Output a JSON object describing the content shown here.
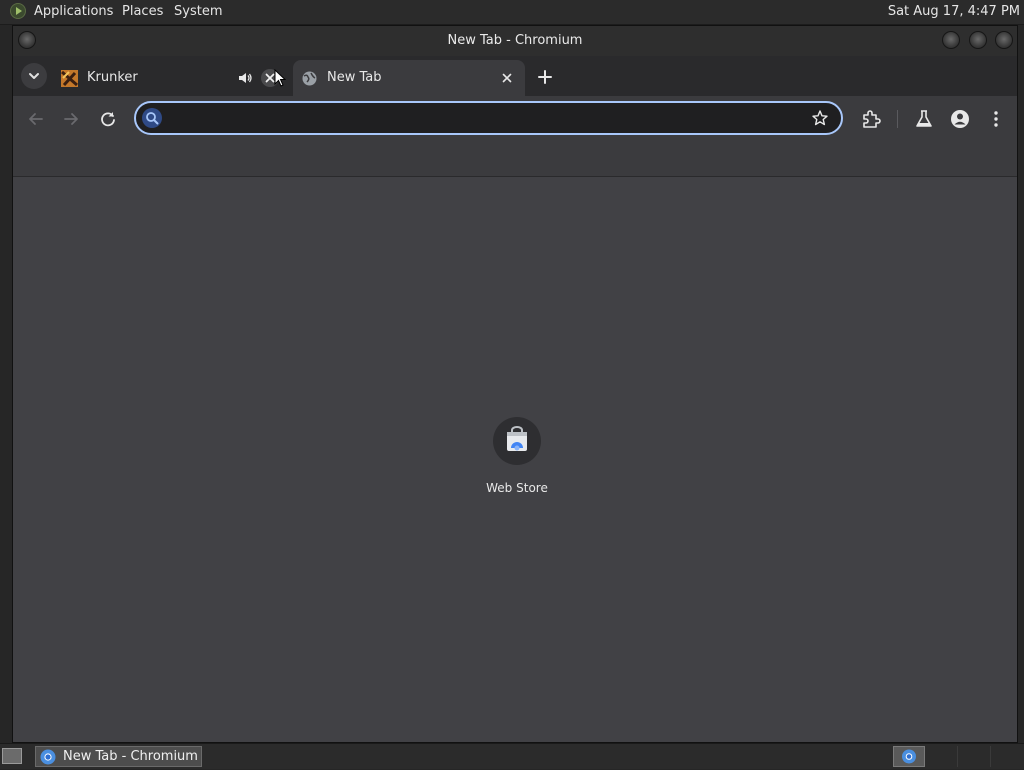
{
  "top_panel": {
    "menus": [
      "Applications",
      "Places",
      "System"
    ],
    "clock": "Sat Aug 17,  4:47 PM"
  },
  "window": {
    "title": "New Tab - Chromium"
  },
  "tabs": [
    {
      "label": "Krunker",
      "active": false,
      "audio": true,
      "favicon": "krunker-favicon"
    },
    {
      "label": "New Tab",
      "active": true,
      "audio": false,
      "favicon": "globe-icon"
    }
  ],
  "toolbar": {
    "omnibox_value": ""
  },
  "content": {
    "shortcuts": [
      {
        "label": "Web Store",
        "icon": "web-store-icon"
      }
    ]
  },
  "taskbar": {
    "items": [
      {
        "label": "New Tab - Chromium",
        "icon": "chromium-icon"
      }
    ]
  },
  "colors": {
    "accent": "#a8c7fa",
    "content_bg": "#414145",
    "toolbar_bg": "#3b3b3e"
  }
}
